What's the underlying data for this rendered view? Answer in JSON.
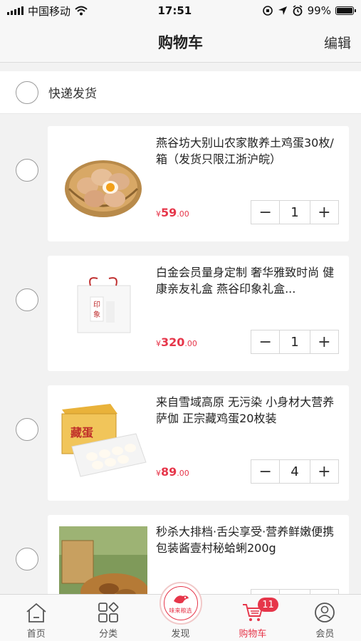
{
  "status_bar": {
    "carrier": "中国移动",
    "time": "17:51",
    "battery": "99%"
  },
  "header": {
    "title": "购物车",
    "edit_label": "编辑"
  },
  "section": {
    "label": "快递发货"
  },
  "items": [
    {
      "title": "燕谷坊大别山农家散养土鸡蛋30枚/箱（发货只限江浙沪皖）",
      "currency": "¥",
      "price_int": "59",
      "price_cents": ".00",
      "quantity": "1",
      "image": "eggs-basket"
    },
    {
      "title": "白金会员量身定制 奢华雅致时尚 健康亲友礼盒 燕谷印象礼盒...",
      "currency": "¥",
      "price_int": "320",
      "price_cents": ".00",
      "quantity": "1",
      "image": "gift-box"
    },
    {
      "title": "来自雪域高原 无污染 小身材大营养 萨伽 正宗藏鸡蛋20枚装",
      "currency": "¥",
      "price_int": "89",
      "price_cents": ".00",
      "quantity": "4",
      "image": "tibet-eggs-box"
    },
    {
      "title": "秒杀大排档·舌尖享受·营养鲜嫩便携包装酱壹村秘蛤蜊200g",
      "currency": "",
      "price_int": "",
      "price_cents": "",
      "quantity": "",
      "image": "clam-package"
    }
  ],
  "stepper": {
    "minus": "−",
    "plus": "+"
  },
  "tabs": [
    {
      "label": "首页",
      "icon": "home-icon"
    },
    {
      "label": "分类",
      "icon": "category-icon"
    },
    {
      "label": "发现",
      "icon": "discover-logo",
      "logo_text": "味来粮选"
    },
    {
      "label": "购物车",
      "icon": "cart-icon",
      "badge": "11"
    },
    {
      "label": "会员",
      "icon": "member-icon"
    }
  ],
  "colors": {
    "accent": "#e6364a",
    "background": "#f2f2f2"
  }
}
